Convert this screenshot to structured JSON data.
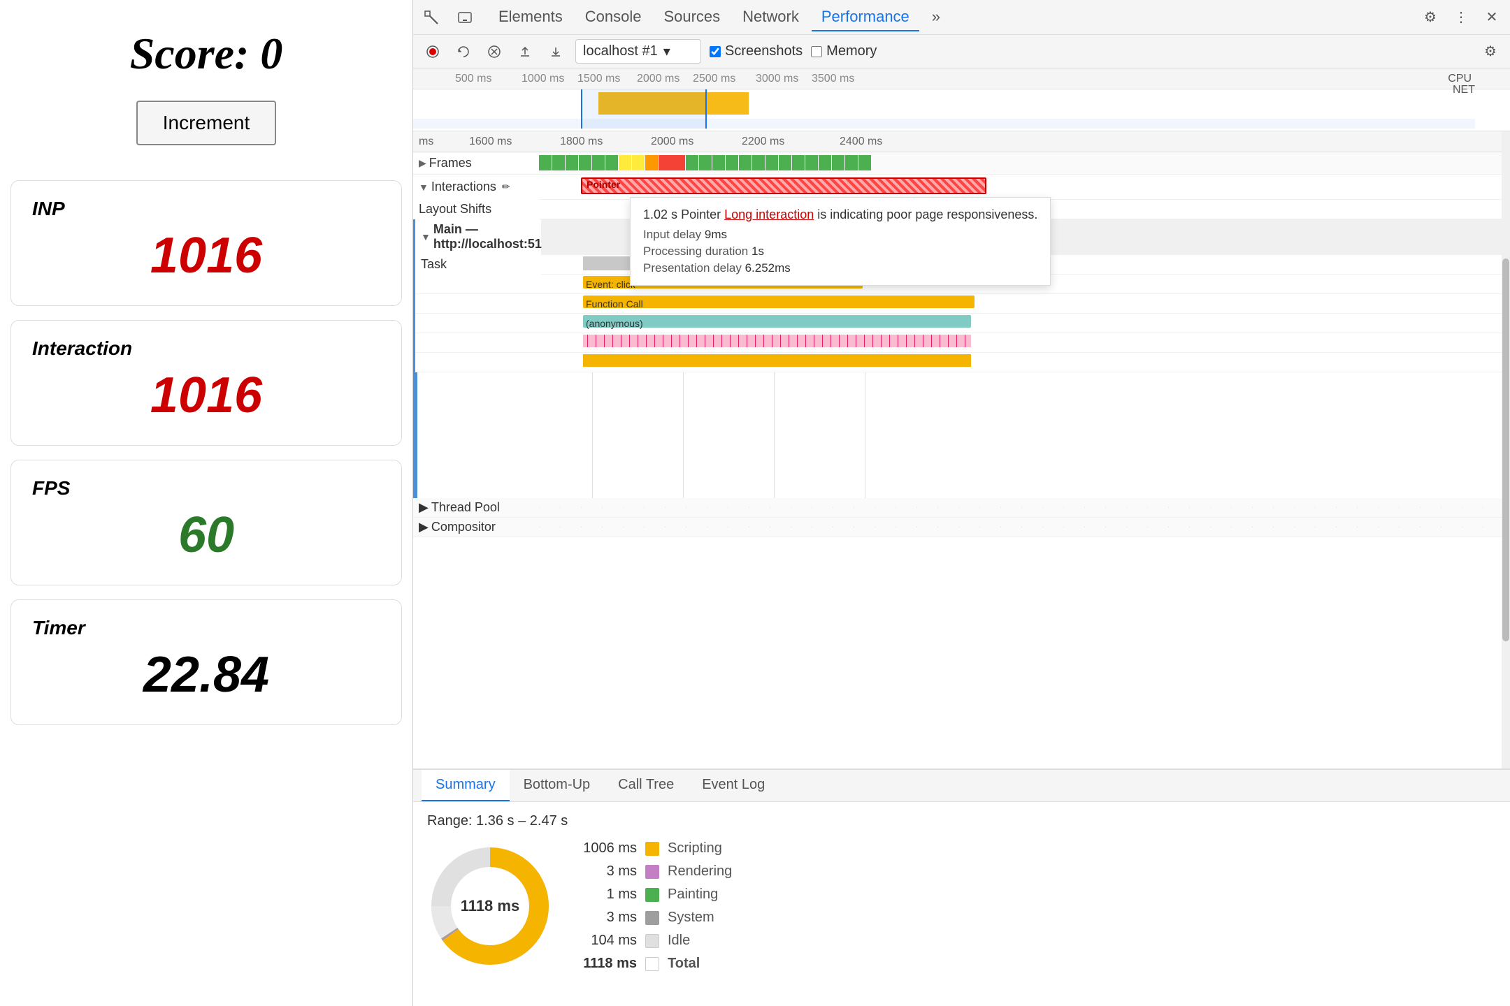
{
  "left": {
    "score_label": "Score: 0",
    "increment_btn": "Increment",
    "metrics": [
      {
        "id": "inp",
        "label": "INP",
        "value": "1016",
        "color": "red"
      },
      {
        "id": "interaction",
        "label": "Interaction",
        "value": "1016",
        "color": "red"
      },
      {
        "id": "fps",
        "label": "FPS",
        "value": "60",
        "color": "green"
      },
      {
        "id": "timer",
        "label": "Timer",
        "value": "22.84",
        "color": "black"
      }
    ]
  },
  "devtools": {
    "tabs": [
      "Elements",
      "Console",
      "Sources",
      "Network",
      "Performance",
      "»"
    ],
    "active_tab": "Performance",
    "toolbar": {
      "url": "localhost #1",
      "screenshots_label": "Screenshots",
      "memory_label": "Memory"
    },
    "timeline": {
      "ruler_labels": [
        "500 ms",
        "1000 ms",
        "15|",
        "ms",
        "2000 ms",
        "2500 m|",
        "3000 ms",
        "3500 m"
      ],
      "detail_labels": [
        "ms",
        "1600 ms",
        "1800 ms",
        "2000 ms",
        "2200 ms",
        "2400 ms"
      ],
      "tracks": {
        "frames_label": "Frames",
        "interactions_label": "Interactions",
        "interaction_item": "Pointer",
        "layout_shifts_label": "Layout Shifts",
        "main_label": "Main — http://localhost:51",
        "task_label": "Task",
        "event_click_label": "Event: click",
        "function_call_label": "Function Call",
        "anonymous_label": "(anonymous)",
        "thread_pool_label": "Thread Pool",
        "compositor_label": "Compositor"
      },
      "tooltip": {
        "duration": "1.02 s",
        "type": "Pointer",
        "link_text": "Long interaction",
        "suffix": "is indicating poor page responsiveness.",
        "input_delay_label": "Input delay",
        "input_delay_val": "9ms",
        "processing_label": "Processing duration",
        "processing_val": "1s",
        "presentation_label": "Presentation delay",
        "presentation_val": "6.252ms"
      }
    },
    "bottom": {
      "tabs": [
        "Summary",
        "Bottom-Up",
        "Call Tree",
        "Event Log"
      ],
      "active_tab": "Summary",
      "range": "Range: 1.36 s – 2.47 s",
      "donut_center": "1118 ms",
      "legend": [
        {
          "value": "1006 ms",
          "color": "#f5b400",
          "name": "Scripting"
        },
        {
          "value": "3 ms",
          "color": "#c47fc4",
          "name": "Rendering"
        },
        {
          "value": "1 ms",
          "color": "#4caf50",
          "name": "Painting"
        },
        {
          "value": "3 ms",
          "color": "#aaa",
          "name": "System"
        },
        {
          "value": "104 ms",
          "color": "#e0e0e0",
          "name": "Idle"
        },
        {
          "value": "1118 ms",
          "color": "transparent",
          "name": "Total",
          "bold": true
        }
      ]
    }
  }
}
